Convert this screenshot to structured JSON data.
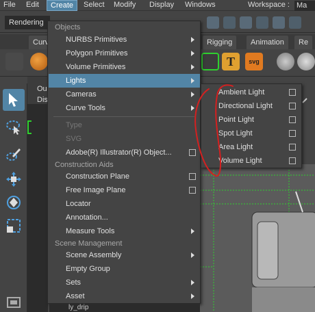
{
  "menubar": {
    "items": [
      "File",
      "Edit",
      "Create",
      "Select",
      "Modify",
      "Display",
      "Windows"
    ],
    "active_index": 2,
    "workspace_label": "Workspace :",
    "workspace_value": "Ma"
  },
  "statusline": {
    "mode": "Rendering"
  },
  "shelf": {
    "tabs": [
      "Curv",
      "Rigging",
      "Animation",
      "Re"
    ]
  },
  "panel": {
    "label_a": "Ou",
    "label_b": "Dis"
  },
  "create_menu": {
    "sections": {
      "objects": "Objects",
      "construction_aids": "Construction Aids",
      "scene_management": "Scene Management"
    },
    "items": [
      {
        "label": "NURBS Primitives"
      },
      {
        "label": "Polygon Primitives"
      },
      {
        "label": "Volume Primitives"
      },
      {
        "label": "Lights"
      },
      {
        "label": "Cameras"
      },
      {
        "label": "Curve Tools"
      },
      {
        "label": "Type"
      },
      {
        "label": "SVG"
      },
      {
        "label": "Adobe(R) Illustrator(R) Object..."
      },
      {
        "label": "Construction Plane"
      },
      {
        "label": "Free Image Plane"
      },
      {
        "label": "Locator"
      },
      {
        "label": "Annotation..."
      },
      {
        "label": "Measure Tools"
      },
      {
        "label": "Scene Assembly"
      },
      {
        "label": "Empty Group"
      },
      {
        "label": "Sets"
      },
      {
        "label": "Asset"
      }
    ]
  },
  "lights_submenu": {
    "items": [
      {
        "label": "Ambient Light"
      },
      {
        "label": "Directional Light"
      },
      {
        "label": "Point Light"
      },
      {
        "label": "Spot Light"
      },
      {
        "label": "Area Light"
      },
      {
        "label": "Volume Light"
      }
    ]
  },
  "outliner_bottom": {
    "label": "ly_drip"
  },
  "colors": {
    "highlight": "#5285a6",
    "menu_bg": "#444444",
    "annotation": "#d42020"
  }
}
